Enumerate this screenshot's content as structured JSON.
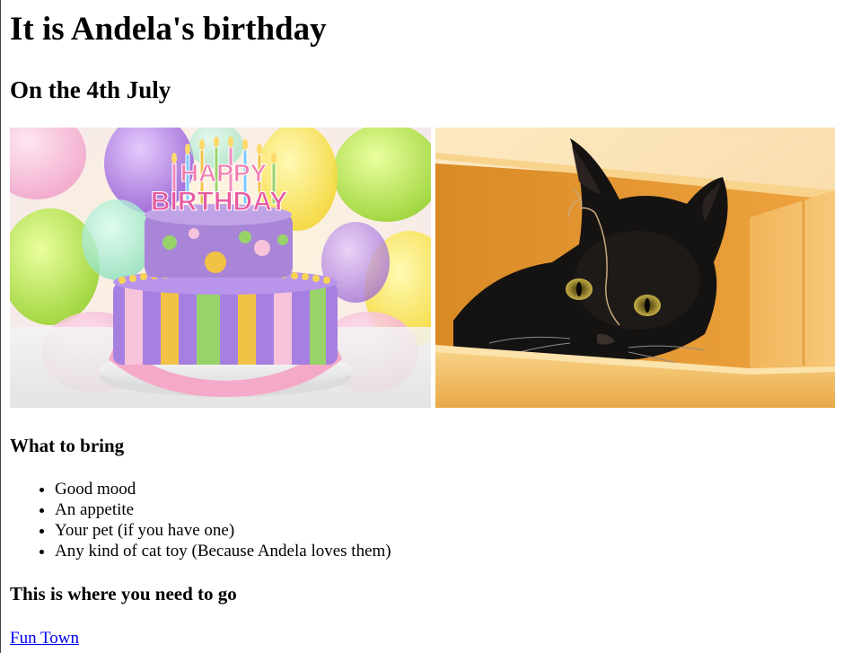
{
  "page": {
    "title": "It is Andela's birthday",
    "date_heading": "On the 4th July"
  },
  "images": {
    "cake": {
      "name": "birthday-cake-image",
      "candle_text_line1": "HAPPY",
      "candle_text_line2": "BIRTHDAY"
    },
    "cat": {
      "name": "black-cat-in-box-image"
    }
  },
  "bring": {
    "heading": "What to bring",
    "items": [
      "Good mood",
      "An appetite",
      "Your pet (if you have one)",
      "Any kind of cat toy (Because Andela loves them)"
    ]
  },
  "location": {
    "heading": "This is where you need to go",
    "link_text": "Fun Town"
  },
  "colors": {
    "link": "#0000ee",
    "text": "#000000",
    "background": "#ffffff"
  }
}
